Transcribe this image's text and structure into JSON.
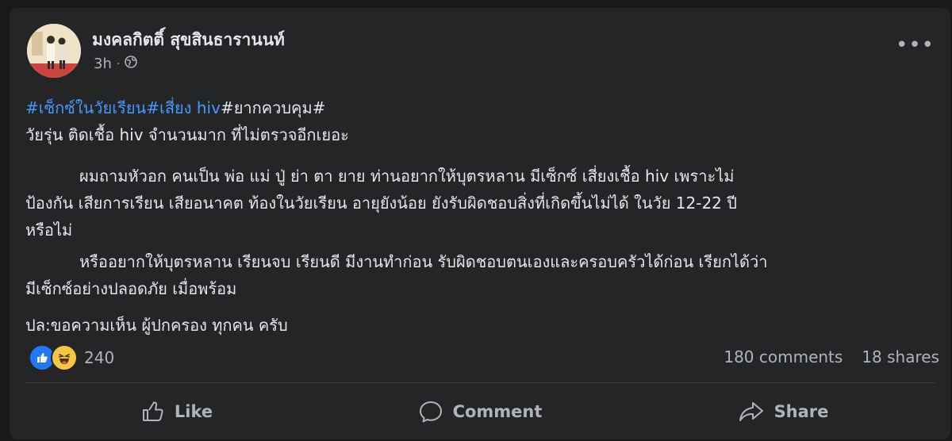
{
  "post": {
    "author": "มงคลกิตติ์ สุขสินธารานนท์",
    "time": "3h",
    "more_label": "•••",
    "privacy_icon": "globe-icon",
    "hashtags": [
      "#เซ็กซ์ในวัยเรียน",
      "#เสี่ยง hiv",
      "#ยากควบคุม#"
    ],
    "lines": [
      "วัยรุ่น ติดเชื้อ hiv จำนวนมาก ที่ไม่ตรวจอีกเยอะ",
      "ผมถามหัวอก คนเป็น พ่อ แม่ ปู่ ย่า ตา ยาย ท่านอยากให้บุตรหลาน มีเซ็กซ์ เสี่ยงเชื้อ  hiv เพราะไม่",
      "ป้องกัน เสียการเรียน เสียอนาคต ท้องในวัยเรียน อายุยังน้อย ยังรับผิดชอบสิ่งที่เกิดขึ้นไม่ได้  ในวัย 12-22 ปี",
      "หรือไม่",
      "หรืออยากให้บุตรหลาน เรียนจบ เรียนดี มีงานทำก่อน รับผิดชอบตนเองและครอบครัวได้ก่อน เรียกได้ว่า",
      "มีเซ็กซ์อย่างปลอดภัย เมื่อพร้อม",
      "ปล:ขอความเห็น ผู้ปกครอง ทุกคน ครับ"
    ]
  },
  "engagement": {
    "reaction_count": "240",
    "comments": "180 comments",
    "shares": "18 shares"
  },
  "actions": {
    "like": "Like",
    "comment": "Comment",
    "share": "Share"
  },
  "colors": {
    "background": "#18191a",
    "card": "#242526",
    "hashtag": "#4599ff",
    "secondary_text": "#b0b3b8"
  }
}
